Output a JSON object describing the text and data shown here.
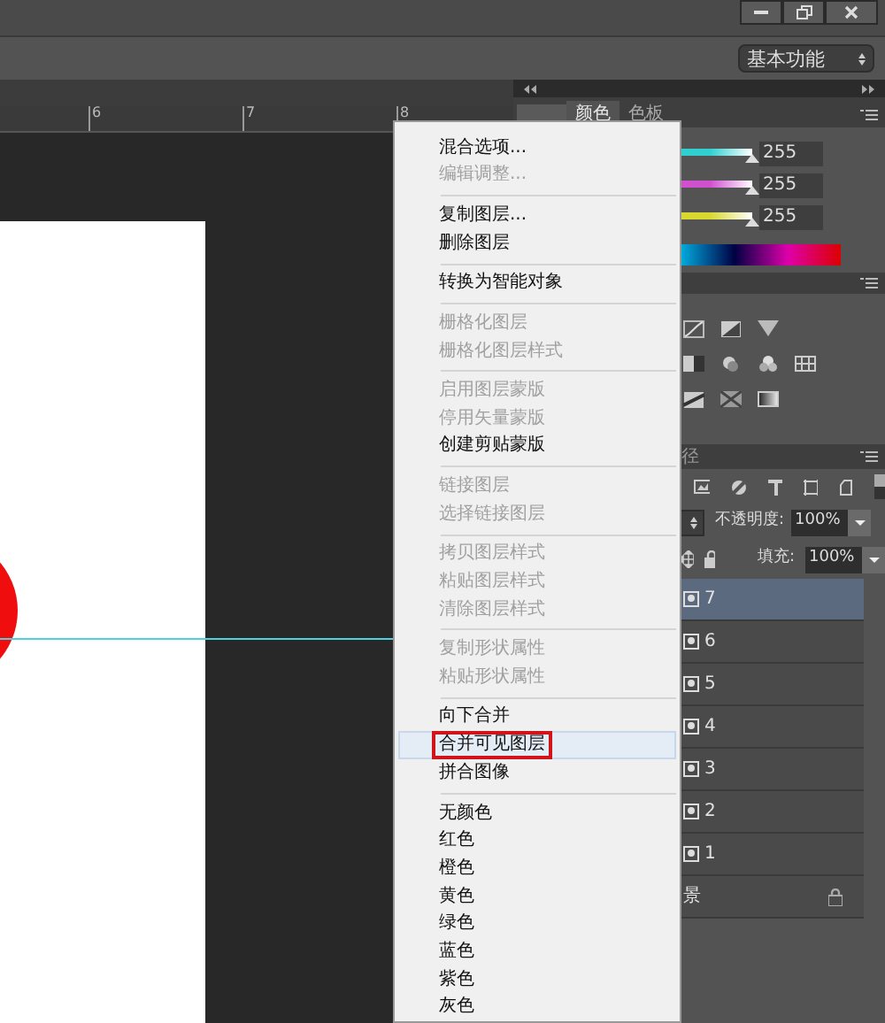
{
  "workspace": {
    "label": "基本功能"
  },
  "ruler": {
    "ticks": [
      "6",
      "7",
      "8"
    ]
  },
  "color_panel": {
    "tabs": [
      {
        "label": "颜色",
        "selected": true
      },
      {
        "label": "色板",
        "selected": false
      }
    ],
    "sliders": [
      {
        "level": 1,
        "reading": "255",
        "color": "#30d0d0"
      },
      {
        "level": 1,
        "reading": "255",
        "color": "#d050d0"
      },
      {
        "level": 1,
        "reading": "255",
        "color": "#d8d830"
      }
    ]
  },
  "layers_panel": {
    "tab": "径",
    "opacity_label": "不透明度:",
    "opacity": "100%",
    "fill_label": "填充:",
    "fill": "100%",
    "layers": [
      {
        "label": "7",
        "kind": "shape",
        "selected": true
      },
      {
        "label": "6",
        "kind": "shape",
        "selected": false
      },
      {
        "label": "5",
        "kind": "shape",
        "selected": false
      },
      {
        "label": "4",
        "kind": "shape",
        "selected": false
      },
      {
        "label": "3",
        "kind": "shape",
        "selected": false
      },
      {
        "label": "2",
        "kind": "shape",
        "selected": false
      },
      {
        "label": "1",
        "kind": "shape",
        "selected": false
      },
      {
        "label": "景",
        "kind": "background",
        "selected": false
      }
    ]
  },
  "context_menu": {
    "groups": [
      [
        {
          "label": "混合选项...",
          "disabled": false,
          "selected": false,
          "outlined": false
        },
        {
          "label": "编辑调整...",
          "disabled": true,
          "selected": false,
          "outlined": false
        }
      ],
      [
        {
          "label": "复制图层...",
          "disabled": false,
          "selected": false,
          "outlined": false
        },
        {
          "label": "删除图层",
          "disabled": false,
          "selected": false,
          "outlined": false
        }
      ],
      [
        {
          "label": "转换为智能对象",
          "disabled": false,
          "selected": false,
          "outlined": false
        }
      ],
      [
        {
          "label": "栅格化图层",
          "disabled": true,
          "selected": false,
          "outlined": false
        },
        {
          "label": "栅格化图层样式",
          "disabled": true,
          "selected": false,
          "outlined": false
        }
      ],
      [
        {
          "label": "启用图层蒙版",
          "disabled": true,
          "selected": false,
          "outlined": false
        },
        {
          "label": "停用矢量蒙版",
          "disabled": true,
          "selected": false,
          "outlined": false
        },
        {
          "label": "创建剪贴蒙版",
          "disabled": false,
          "selected": false,
          "outlined": false
        }
      ],
      [
        {
          "label": "链接图层",
          "disabled": true,
          "selected": false,
          "outlined": false
        },
        {
          "label": "选择链接图层",
          "disabled": true,
          "selected": false,
          "outlined": false
        }
      ],
      [
        {
          "label": "拷贝图层样式",
          "disabled": true,
          "selected": false,
          "outlined": false
        },
        {
          "label": "粘贴图层样式",
          "disabled": true,
          "selected": false,
          "outlined": false
        },
        {
          "label": "清除图层样式",
          "disabled": true,
          "selected": false,
          "outlined": false
        }
      ],
      [
        {
          "label": "复制形状属性",
          "disabled": true,
          "selected": false,
          "outlined": false
        },
        {
          "label": "粘贴形状属性",
          "disabled": true,
          "selected": false,
          "outlined": false
        }
      ],
      [
        {
          "label": "向下合并",
          "disabled": false,
          "selected": false,
          "outlined": false
        },
        {
          "label": "合并可见图层",
          "disabled": false,
          "selected": true,
          "outlined": true
        },
        {
          "label": "拼合图像",
          "disabled": false,
          "selected": false,
          "outlined": false
        }
      ],
      [
        {
          "label": "无颜色",
          "disabled": false,
          "selected": false,
          "outlined": false
        },
        {
          "label": "红色",
          "disabled": false,
          "selected": false,
          "outlined": false
        },
        {
          "label": "橙色",
          "disabled": false,
          "selected": false,
          "outlined": false
        },
        {
          "label": "黄色",
          "disabled": false,
          "selected": false,
          "outlined": false
        },
        {
          "label": "绿色",
          "disabled": false,
          "selected": false,
          "outlined": false
        },
        {
          "label": "蓝色",
          "disabled": false,
          "selected": false,
          "outlined": false
        },
        {
          "label": "紫色",
          "disabled": false,
          "selected": false,
          "outlined": false
        },
        {
          "label": "灰色",
          "disabled": false,
          "selected": false,
          "outlined": false
        }
      ]
    ]
  }
}
